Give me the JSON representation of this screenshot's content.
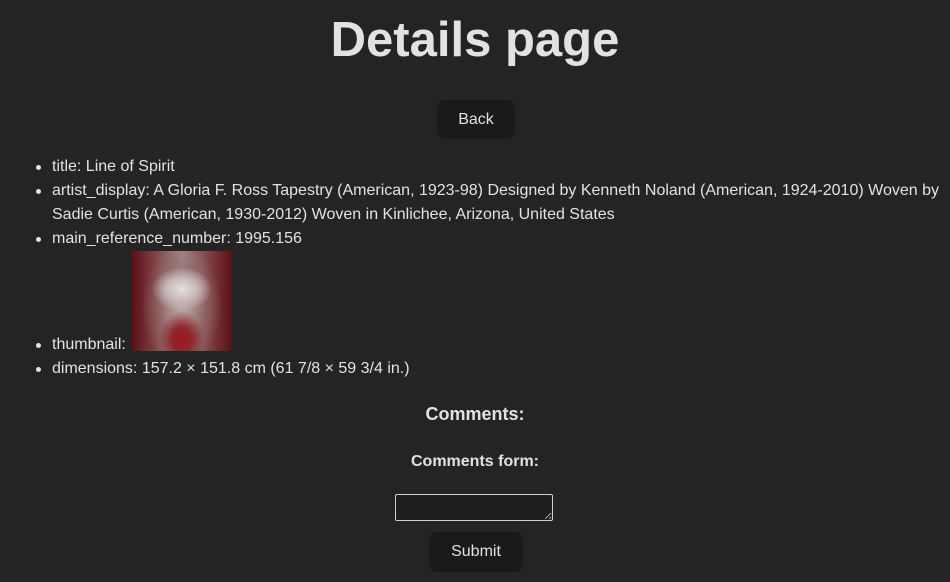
{
  "page": {
    "title": "Details page",
    "back_label": "Back"
  },
  "details": {
    "title": "title: Line of Spirit",
    "artist_display": "artist_display: A Gloria F. Ross Tapestry (American, 1923-98) Designed by Kenneth Noland (American, 1924-2010) Woven by Sadie Curtis (American, 1930-2012) Woven in Kinlichee, Arizona, United States",
    "main_reference_number": "main_reference_number: 1995.156",
    "thumbnail_label": "thumbnail:",
    "dimensions": "dimensions: 157.2 × 151.8 cm (61 7/8 × 59 3/4 in.)"
  },
  "comments": {
    "heading": "Comments:",
    "form_heading": "Comments form:",
    "input_value": "",
    "submit_label": "Submit"
  }
}
